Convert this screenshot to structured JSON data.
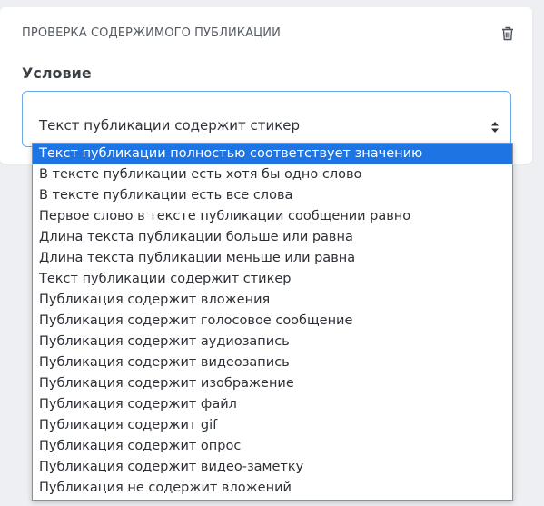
{
  "card": {
    "title": "ПРОВЕРКА СОДЕРЖИМОГО ПУБЛИКАЦИИ",
    "delete_icon": "trash-icon"
  },
  "condition": {
    "label": "Условие",
    "selected_value": "Текст публикации содержит стикер",
    "arrow_icon": "sort-arrows-icon"
  },
  "dropdown": {
    "highlighted_index": 0,
    "options": [
      "Текст публикации полностью соответствует значению",
      "В тексте публикации есть хотя бы одно слово",
      "В тексте публикации есть все слова",
      "Первое слово в тексте публикации сообщении равно",
      "Длина текста публикации больше или равна",
      "Длина текста публикации меньше или равна",
      "Текст публикации содержит стикер",
      "Публикация содержит вложения",
      "Публикация содержит голосовое сообщение",
      "Публикация содержит аудиозапись",
      "Публикация содержит видеозапись",
      "Публикация содержит изображение",
      "Публикация содержит файл",
      "Публикация содержит gif",
      "Публикация содержит опрос",
      "Публикация содержит видео-заметку",
      "Публикация не содержит вложений"
    ]
  },
  "colors": {
    "highlight": "#1e74e3",
    "select_border": "#6fa8e6",
    "background": "#edeff2"
  }
}
